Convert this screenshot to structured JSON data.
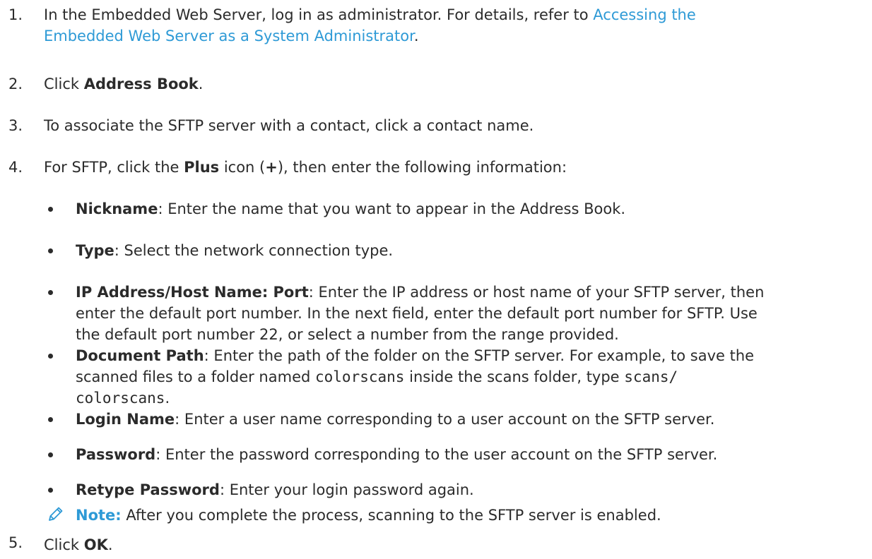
{
  "steps": [
    {
      "num": "1.",
      "pre": "In the Embedded Web Server, log in as administrator. For details, refer to ",
      "link_line1": "Accessing the",
      "link_line2": "Embedded Web Server as a System Administrator",
      "post": "."
    },
    {
      "num": "2.",
      "pre": "Click ",
      "bold": "Address Book",
      "post": "."
    },
    {
      "num": "3.",
      "text": "To associate the SFTP server with a contact, click a contact name."
    },
    {
      "num": "4.",
      "pre": "For SFTP, click the ",
      "bold": "Plus",
      "mid": " icon (",
      "bold2": "+",
      "post": "), then enter the following information:"
    },
    {
      "num": "5.",
      "pre": "Click ",
      "bold": "OK",
      "post": "."
    }
  ],
  "bullets": [
    {
      "label": "Nickname",
      "text": ": Enter the name that you want to appear in the Address Book."
    },
    {
      "label": "Type",
      "text": ": Select the network connection type."
    },
    {
      "label": "IP Address/Host Name: Port",
      "text_line1": ": Enter the IP address or host name of your SFTP server, then",
      "text_line2": "enter the default port number. In the next field, enter the default port number for SFTP. Use",
      "text_line3": "the default port number 22, or select a number from the range provided."
    },
    {
      "label": "Document Path",
      "text_line1a": ": Enter the path of the folder on the SFTP server. For example, to save the",
      "text_line2a": "scanned files to a folder named ",
      "code1": "colorscans",
      "text_line2b": " inside the scans folder, type ",
      "code2a": "scans/",
      "code2b": "colorscans",
      "text_line3b": "."
    },
    {
      "label": "Login Name",
      "text": ": Enter a user name corresponding to a user account on the SFTP server."
    },
    {
      "label": "Password",
      "text": ": Enter the password corresponding to the user account on the SFTP server."
    },
    {
      "label": "Retype Password",
      "text": ": Enter your login password again."
    }
  ],
  "note": {
    "label": "Note:",
    "text": " After you complete the process, scanning to the SFTP server is enabled.",
    "icon": "pencil-icon"
  },
  "colors": {
    "link": "#2e9ad6",
    "text": "#2b2b2b"
  }
}
